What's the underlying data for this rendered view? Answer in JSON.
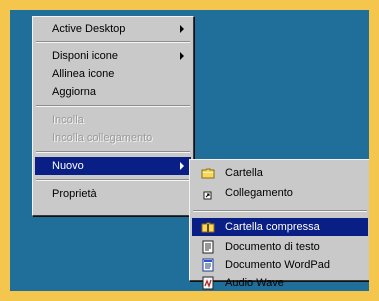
{
  "context_menu": {
    "items": [
      {
        "label": "Active Desktop"
      },
      {
        "label": "Disponi icone"
      },
      {
        "label": "Allinea icone"
      },
      {
        "label": "Aggiorna"
      },
      {
        "label": "Incolla"
      },
      {
        "label": "Incolla collegamento"
      },
      {
        "label": "Nuovo"
      },
      {
        "label": "Proprietà"
      }
    ]
  },
  "submenu": {
    "items": [
      {
        "label": "Cartella",
        "icon": "folder-icon"
      },
      {
        "label": "Collegamento",
        "icon": "shortcut-icon"
      },
      {
        "label": "Cartella compressa",
        "icon": "zip-folder-icon"
      },
      {
        "label": "Documento di testo",
        "icon": "text-document-icon"
      },
      {
        "label": "Documento WordPad",
        "icon": "wordpad-document-icon"
      },
      {
        "label": "Audio Wave",
        "icon": "audio-wave-icon"
      }
    ]
  },
  "colors": {
    "frame": "#f4c64e",
    "desktop": "#1f6f9a",
    "menu_bg": "#c9c9c9",
    "selection": "#0a1f86"
  }
}
